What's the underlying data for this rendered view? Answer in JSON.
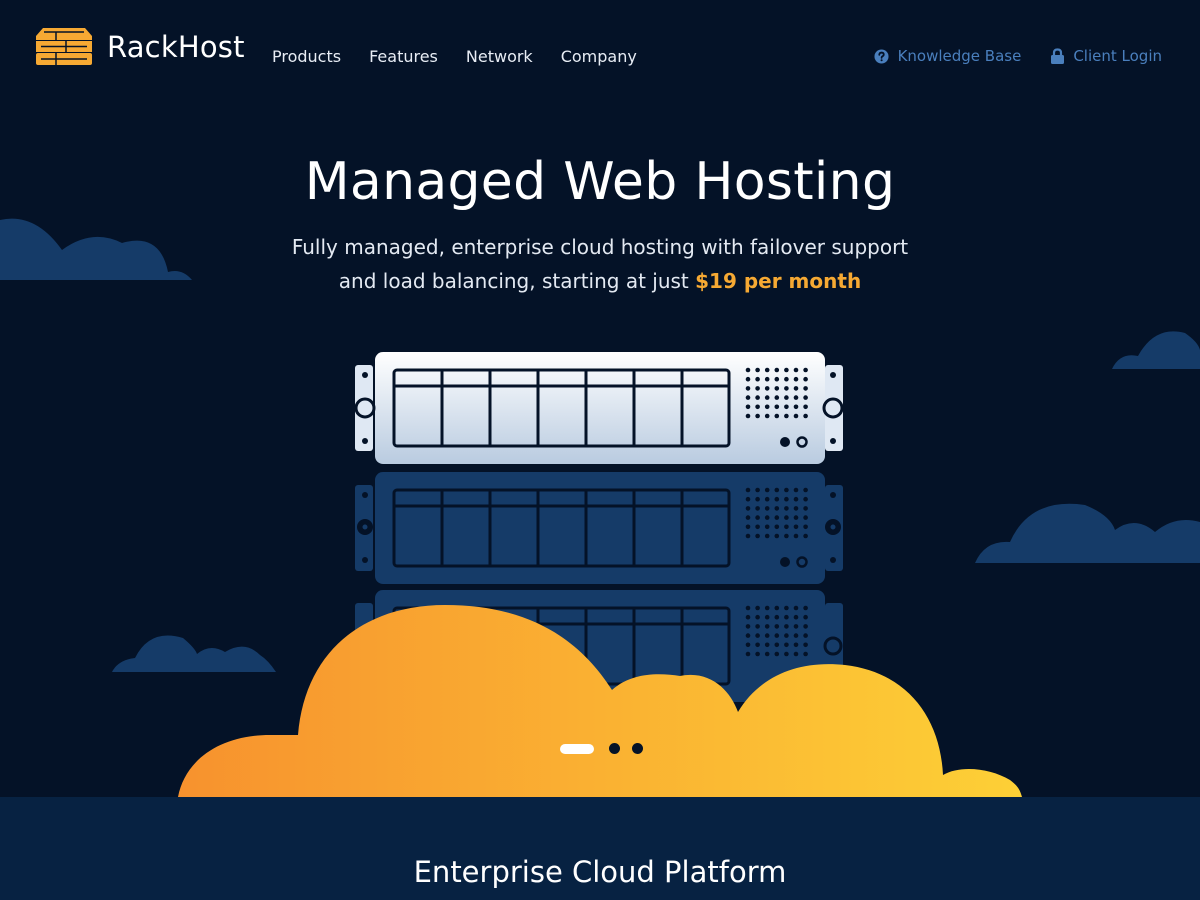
{
  "brand": {
    "name": "RackHost",
    "logo_icon": "server-stack-icon",
    "logo_color": "#f6a933"
  },
  "nav": {
    "items": [
      {
        "label": "Products"
      },
      {
        "label": "Features"
      },
      {
        "label": "Network"
      },
      {
        "label": "Company"
      }
    ]
  },
  "utility": {
    "knowledge_base": {
      "label": "Knowledge Base",
      "icon": "question-circle-icon"
    },
    "client_login": {
      "label": "Client Login",
      "icon": "lock-icon"
    }
  },
  "hero": {
    "title": "Managed Web Hosting",
    "subtitle_line1": "Fully managed, enterprise cloud hosting with failover support",
    "subtitle_line2_prefix": "and load balancing, starting at just ",
    "subtitle_price": "$19 per month",
    "slider": {
      "count": 3,
      "active": 1
    }
  },
  "section": {
    "title": "Enterprise Cloud Platform"
  },
  "colors": {
    "background": "#041227",
    "accent": "#f6a933",
    "link": "#4a7fbd",
    "cloud_dark": "#153b68",
    "section_bg": "#072242"
  }
}
